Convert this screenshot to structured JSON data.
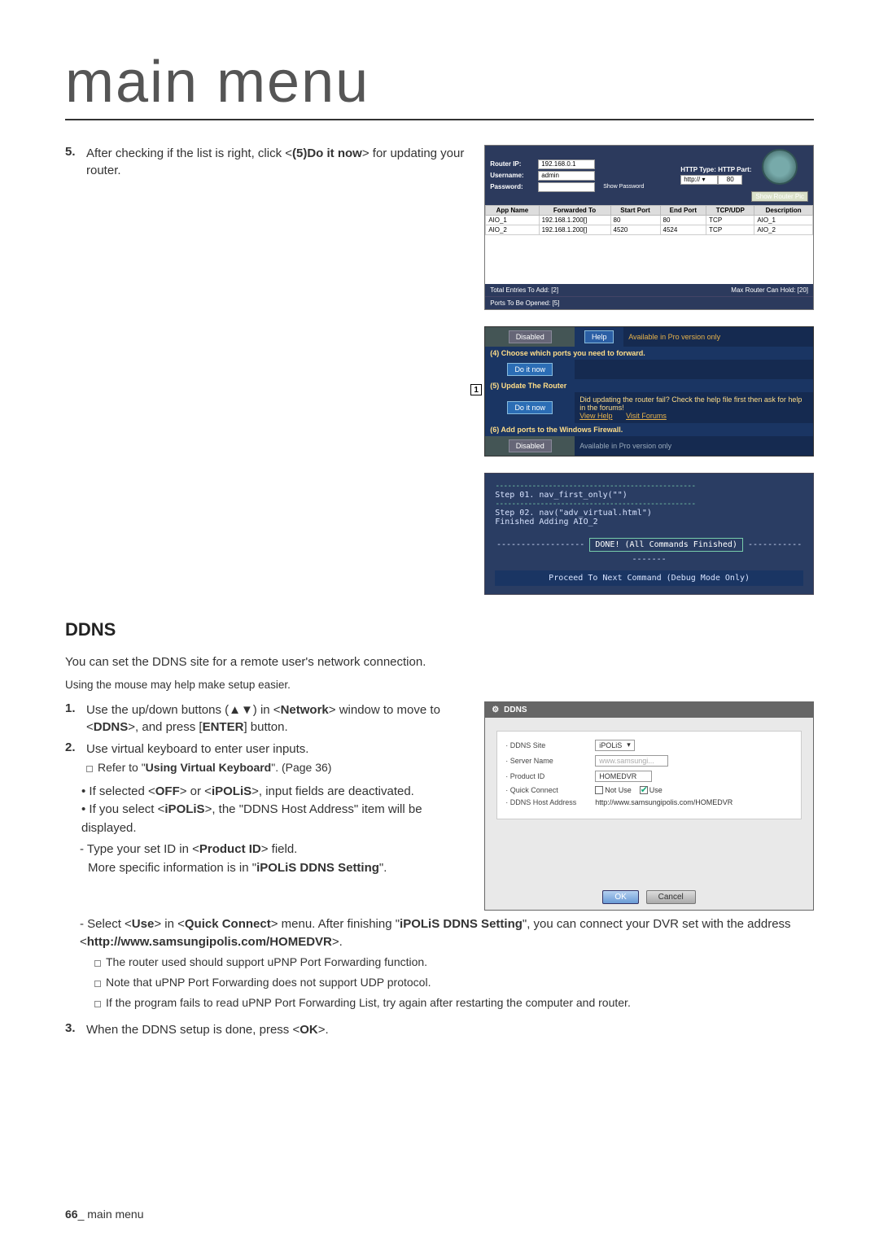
{
  "page": {
    "title": "main menu",
    "footer_page": "66",
    "footer_label": "_ main menu"
  },
  "step5": {
    "num": "5.",
    "text_a": "After checking if the list is right, click <",
    "text_b": "(5)Do it now",
    "text_c": "> for updating your router."
  },
  "router": {
    "ip_label": "Router IP:",
    "ip": "192.168.0.1",
    "user_label": "Username:",
    "user": "admin",
    "pass_label": "Password:",
    "show_pw": "Show Password",
    "http_type": "HTTP Type:",
    "http_val": "http:// ▾",
    "http_port_label": "HTTP Part:",
    "http_port": "80",
    "show_router": "Show Router Pic",
    "headers": [
      "App Name",
      "Forwarded To",
      "Start Port",
      "End Port",
      "TCP/UDP",
      "Description"
    ],
    "rows": [
      [
        "AIO_1",
        "192.168.1.200[]",
        "80",
        "80",
        "TCP",
        "AIO_1"
      ],
      [
        "AIO_2",
        "192.168.1.200[]",
        "4520",
        "4524",
        "TCP",
        "AIO_2"
      ]
    ],
    "footer_left": "Total Entries To Add: [2]",
    "footer_mid": "Max Router Can Hold: [20]",
    "footer_right": "Ports To Be Opened: [5]"
  },
  "wizard": {
    "row3_btn": "Disabled",
    "row3_help": "Help",
    "row3_text": "Available in Pro version only",
    "head4": "(4) Choose which ports you need to forward.",
    "row4_btn": "Do it now",
    "callout": "1",
    "head5": "(5) Update The Router",
    "row5_btn": "Do it now",
    "row5_text1": "Did updating the router fail? Check the help file first then ask for help in the forums!",
    "row5_link1": "View Help",
    "row5_link2": "Visit Forums",
    "head6": "(6) Add ports to the Windows Firewall.",
    "row6_btn": "Disabled",
    "row6_text": "Available in Pro version only"
  },
  "console": {
    "l1": "Step 01. nav_first_only(\"\")",
    "l2": "Step 02. nav(\"adv_virtual.html\")",
    "l3": "Finished Adding AIO_2",
    "done": "DONE! (All Commands Finished)",
    "proceed": "Proceed To Next Command (Debug Mode Only)"
  },
  "ddns_section": {
    "heading": "DDNS",
    "intro": "You can set the DDNS site for a remote user's network connection.",
    "note": "Using the mouse may help make setup easier.",
    "s1_num": "1.",
    "s1_a": "Use the up/down buttons (▲▼) in <",
    "s1_b": "Network",
    "s1_c": "> window to move to <",
    "s1_d": "DDNS",
    "s1_e": ">, and press [",
    "s1_f": "ENTER",
    "s1_g": "] button.",
    "s2_num": "2.",
    "s2_a": "Use virtual keyboard to enter user inputs.",
    "s2_ref_a": "Refer to \"",
    "s2_ref_b": "Using Virtual Keyboard",
    "s2_ref_c": "\". (Page 36)",
    "b1_a": "If selected <",
    "b1_b": "OFF",
    "b1_c": "> or <",
    "b1_d": "iPOLiS",
    "b1_e": ">, input fields are deactivated.",
    "b2_a": "If you select <",
    "b2_b": "iPOLiS",
    "b2_c": ">, the \"DDNS Host Address\" item will be displayed.",
    "d1_a": "Type your set ID in <",
    "d1_b": "Product ID",
    "d1_c": "> field.",
    "d1_more_a": "More specific information is in \"",
    "d1_more_b": "iPOLiS DDNS Setting",
    "d1_more_c": "\".",
    "d2_a": "Select <",
    "d2_b": "Use",
    "d2_c": "> in <",
    "d2_d": "Quick Connect",
    "d2_e": "> menu. After finishing \"",
    "d2_f": "iPOLiS DDNS Setting",
    "d2_g": "\", you can connect your DVR set with the address <",
    "d2_h": "http://www.samsungipolis.com/HOMEDVR",
    "d2_i": ">.",
    "n1": "The router used should support uPNP Port Forwarding function.",
    "n2": "Note that uPNP Port Forwarding does not support UDP protocol.",
    "n3": "If the program fails to read uPNP Port Forwarding List, try again after restarting the computer and router.",
    "s3_num": "3.",
    "s3_a": "When the DDNS setup is done, press <",
    "s3_b": "OK",
    "s3_c": ">."
  },
  "ddns_box": {
    "title": "DDNS",
    "rows": {
      "site_label": "· DDNS Site",
      "site_val": "iPOLiS",
      "server_label": "· Server Name",
      "server_val": "www.samsungi...",
      "product_label": "· Product ID",
      "product_val": "HOMEDVR",
      "quick_label": "· Quick Connect",
      "quick_notuse": "Not Use",
      "quick_use": "Use",
      "host_label": "· DDNS Host Address",
      "host_val": "http://www.samsungipolis.com/HOMEDVR"
    },
    "ok": "OK",
    "cancel": "Cancel"
  }
}
